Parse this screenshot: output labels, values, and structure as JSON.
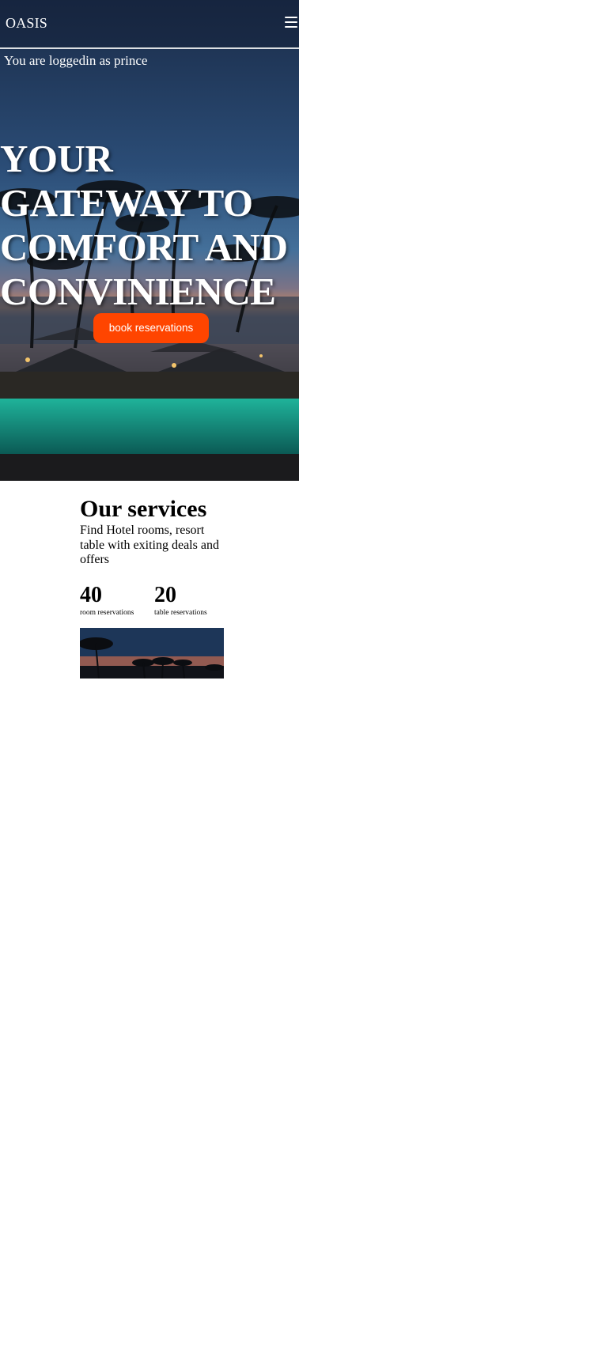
{
  "navbar": {
    "brand": "OASIS",
    "menu_icon": "hamburger-menu-icon"
  },
  "hero": {
    "logged_in_text": "You are loggedin as prince",
    "title_lines": [
      "YOUR",
      "GATEWAY TO",
      "COMFORT AND",
      "CONVINIENCE"
    ],
    "cta_label": "book reservations",
    "background_image": "night resort pool with palm trees",
    "colors": {
      "cta": "#ff4500",
      "text": "#ffffff"
    }
  },
  "services": {
    "title": "Our services",
    "subtitle": "Find Hotel rooms, resort table with exiting deals and offers",
    "stats": [
      {
        "value": "40",
        "label": "room reservations"
      },
      {
        "value": "20",
        "label": "table reservations"
      }
    ],
    "image": "palm trees at dusk"
  }
}
